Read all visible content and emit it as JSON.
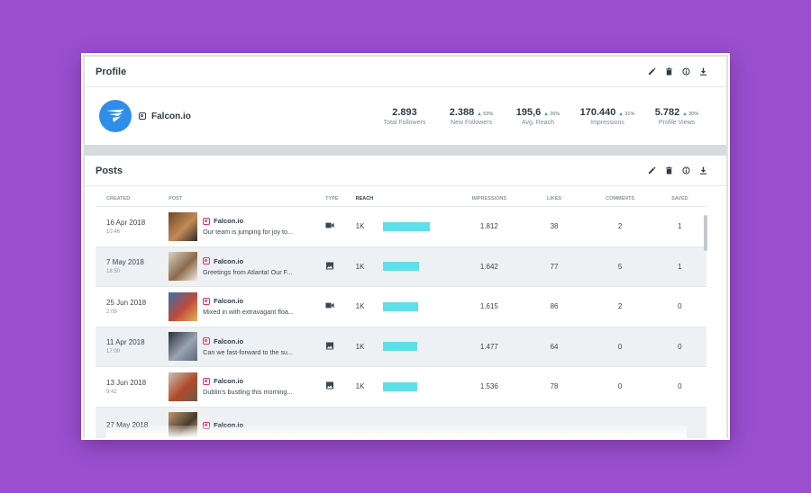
{
  "profile": {
    "title": "Profile",
    "handle": "Falcon.io",
    "stats": [
      {
        "value": "2.893",
        "change": "",
        "label": "Total Followers"
      },
      {
        "value": "2.388",
        "change": "53%",
        "label": "New Followers"
      },
      {
        "value": "195,6",
        "change": "26%",
        "label": "Avg. Reach"
      },
      {
        "value": "170.440",
        "change": "31%",
        "label": "Impressions"
      },
      {
        "value": "5.782",
        "change": "30%",
        "label": "Profile Views"
      }
    ]
  },
  "toolbar_icons": [
    "pencil-icon",
    "trash-icon",
    "info-icon",
    "download-icon"
  ],
  "posts": {
    "title": "Posts",
    "columns": {
      "created": "CREATED",
      "post": "POST",
      "type": "TYPE",
      "reach": "REACH",
      "impressions": "IMPRESSIONS",
      "likes": "LIKES",
      "comments": "COMMENTS",
      "saved": "SAVED"
    },
    "rows": [
      {
        "date": "16 Apr 2018",
        "time": "10:46",
        "account": "Falcon.io",
        "message": "Our team is jumping for joy to...",
        "type": "video-icon",
        "reach": "1K",
        "reach_fraction": 0.92,
        "impressions": "1.812",
        "likes": "38",
        "comments": "2",
        "saved": "1"
      },
      {
        "date": "7 May 2018",
        "time": "18:50",
        "account": "Falcon.io",
        "message": "Greetings from Atlanta! Our F...",
        "type": "image-icon",
        "reach": "1K",
        "reach_fraction": 0.72,
        "impressions": "1.642",
        "likes": "77",
        "comments": "5",
        "saved": "1"
      },
      {
        "date": "25 Jun 2018",
        "time": "2:09",
        "account": "Falcon.io",
        "message": "Mixed in with extravagant floa...",
        "type": "video-icon",
        "reach": "1K",
        "reach_fraction": 0.7,
        "impressions": "1.615",
        "likes": "86",
        "comments": "2",
        "saved": "0"
      },
      {
        "date": "11 Apr 2018",
        "time": "17:00",
        "account": "Falcon.io",
        "message": "Can we fast-forward to the su...",
        "type": "image-icon",
        "reach": "1K",
        "reach_fraction": 0.67,
        "impressions": "1.477",
        "likes": "64",
        "comments": "0",
        "saved": "0"
      },
      {
        "date": "13 Jun 2018",
        "time": "9:42",
        "account": "Falcon.io",
        "message": "Dublin's bustling this morning...",
        "type": "image-icon",
        "reach": "1K",
        "reach_fraction": 0.68,
        "impressions": "1.536",
        "likes": "78",
        "comments": "0",
        "saved": "0"
      },
      {
        "date": "27 May 2018",
        "time": "",
        "account": "Falcon.io",
        "message": "",
        "type": "",
        "reach": "",
        "reach_fraction": 0,
        "impressions": "",
        "likes": "",
        "comments": "",
        "saved": ""
      }
    ]
  },
  "colors": {
    "background": "#9b4fcf",
    "reach_bar": "#5de0e8",
    "accent_up": "#29b463",
    "avatar": "#2f8fe8",
    "instagram": "#e1306c"
  }
}
